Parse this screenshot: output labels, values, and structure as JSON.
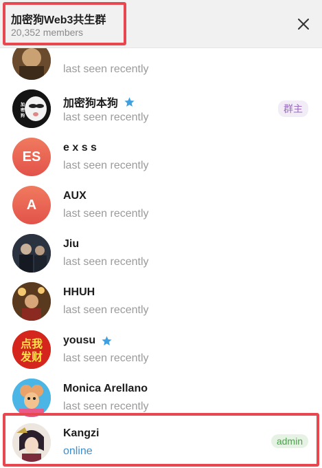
{
  "header": {
    "title": "加密狗Web3共生群",
    "subtitle": "20,352 members"
  },
  "members": [
    {
      "name": "",
      "status": "last seen recently",
      "avatar_icon": "photo-avatar",
      "avatar_color": "#7a5c3a"
    },
    {
      "name": "加密狗本狗",
      "status": "last seen recently",
      "verified": true,
      "badge": "群主",
      "avatar_icon": "dog-avatar",
      "avatar_color": "#1e1e1e"
    },
    {
      "name": "e x s s",
      "status": "last seen recently",
      "initials": "ES",
      "avatar_color": "#ea5f52"
    },
    {
      "name": "AUX",
      "status": "last seen recently",
      "initials": "A",
      "avatar_color": "#ea5f52"
    },
    {
      "name": "Jiu",
      "status": "last seen recently",
      "avatar_icon": "photo-avatar",
      "avatar_color": "#2b3340"
    },
    {
      "name": "HHUH",
      "status": "last seen recently",
      "avatar_icon": "photo-avatar",
      "avatar_color": "#8a5a2c"
    },
    {
      "name": "yousu",
      "status": "last seen recently",
      "verified": true,
      "avatar_icon": "text-avatar",
      "avatar_text": "点我\n发财",
      "avatar_color": "#d4261c"
    },
    {
      "name": "Monica Arellano",
      "status": "last seen recently",
      "avatar_icon": "cartoon-mouse-avatar",
      "avatar_color": "#4bb6e6"
    },
    {
      "name": "Kangzi",
      "status": "online",
      "badge": "admin",
      "avatar_icon": "anime-avatar",
      "avatar_color": "#e8e2dc"
    }
  ],
  "colors": {
    "highlight": "#e8474f",
    "online": "#3a8fd0",
    "verified_star": "#3fa0e0",
    "owner_badge_text": "#9a6cbf",
    "admin_badge_text": "#4aa14a"
  }
}
